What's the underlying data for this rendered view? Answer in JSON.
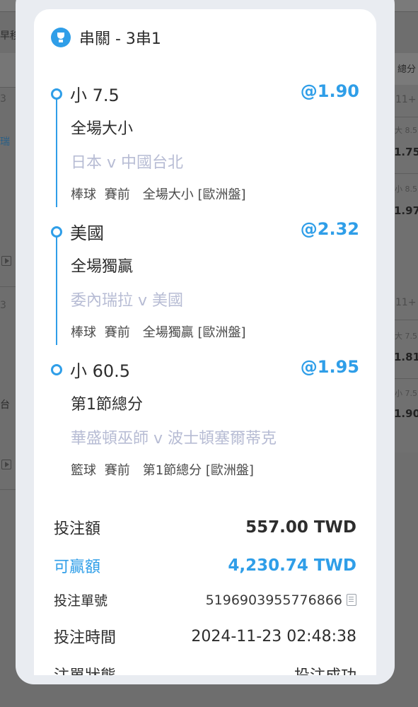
{
  "background": {
    "left_texts": [
      "早移",
      "3",
      "瑞",
      "3",
      "台"
    ],
    "right_header": "總分",
    "right_rows": [
      {
        "line": "11+",
        "label": "大 8.5",
        "odds": "1.75"
      },
      {
        "label": "小 8.5",
        "odds": "1.97"
      },
      {
        "line": "11+",
        "label": "大 7.5",
        "odds": "1.81"
      },
      {
        "label": "小 7.5",
        "odds": "1.90"
      }
    ]
  },
  "bet": {
    "title": "串關 - 3串1",
    "legs": [
      {
        "selection": "小 7.5",
        "odds": "@1.90",
        "market": "全場大小",
        "match": "日本 v 中國台北",
        "sport": "棒球",
        "phase": "賽前",
        "detail": "全場大小 [歐洲盤]"
      },
      {
        "selection": "美國",
        "odds": "@2.32",
        "market": "全場獨贏",
        "match": "委內瑞拉 v 美國",
        "sport": "棒球",
        "phase": "賽前",
        "detail": "全場獨贏 [歐洲盤]"
      },
      {
        "selection": "小 60.5",
        "odds": "@1.95",
        "market": "第1節總分",
        "match": "華盛頓巫師 v 波士頓塞爾蒂克",
        "sport": "籃球",
        "phase": "賽前",
        "detail": "第1節總分 [歐洲盤]"
      }
    ],
    "summary": {
      "stake_label": "投注額",
      "stake_value": "557.00 TWD",
      "win_label": "可贏額",
      "win_value": "4,230.74 TWD",
      "ticket_label": "投注單號",
      "ticket_value": "5196903955776866",
      "time_label": "投注時間",
      "time_value": "2024-11-23 02:48:38",
      "status_label": "注單狀態",
      "status_value": "投注成功"
    },
    "colors": {
      "accent": "#2f9ee8",
      "match_text": "#b7bcd4"
    },
    "icons": {
      "title": "trophy-icon",
      "copy": "copy-icon"
    }
  }
}
